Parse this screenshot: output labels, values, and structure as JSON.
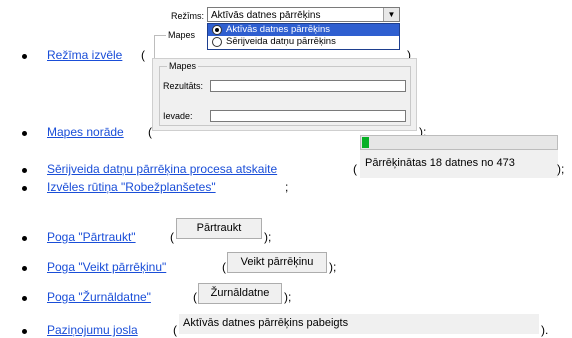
{
  "list": {
    "mode_select": {
      "link": "Režīma izvēle",
      "open": "(",
      "close": ")"
    },
    "folder_input": {
      "link": "Mapes norāde",
      "open": "(",
      "close": ");"
    },
    "batch_report": {
      "link": "Sērijveida datņu pārrēķina procesa atskaite",
      "open": "(",
      "close": ");"
    },
    "checkbox_item": {
      "link": "Izvēles rūtiņa \"Robežplanšetes\"",
      "close": ";"
    },
    "stop_button": {
      "link": "Poga \"Pārtraukt\"",
      "open": "(",
      "close": ");"
    },
    "run_button": {
      "link": "Poga \"Veikt pārrēķinu\"",
      "open": "(",
      "close": ");"
    },
    "log_button": {
      "link": "Poga \"Žurnāldatne\"",
      "open": "(",
      "close": ");"
    },
    "notify_bar": {
      "link": "Paziņojumu josla",
      "open": "(",
      "close": ")."
    }
  },
  "mode_ui": {
    "label": "Režīms:",
    "selected": "Aktīvās datnes pārrēķins",
    "behind_label": "Mapes",
    "options": [
      "Aktīvās datnes pārrēķins",
      "Sērijveida datņu pārrēķins"
    ]
  },
  "folder_ui": {
    "group_label": "Mapes",
    "result_label": "Rezultāts:",
    "input_label": "Ievade:"
  },
  "progress_ui": {
    "status_text": "Pārrēķinātas 18 datnes no 473",
    "progress": 0.038,
    "bar_color": "#06b025"
  },
  "buttons": {
    "stop": "Pārtraukt",
    "run": "Veikt pārrēķinu",
    "log": "Žurnāldatne"
  },
  "status_bar": {
    "text": "Aktīvās datnes pārrēķins pabeigts"
  }
}
